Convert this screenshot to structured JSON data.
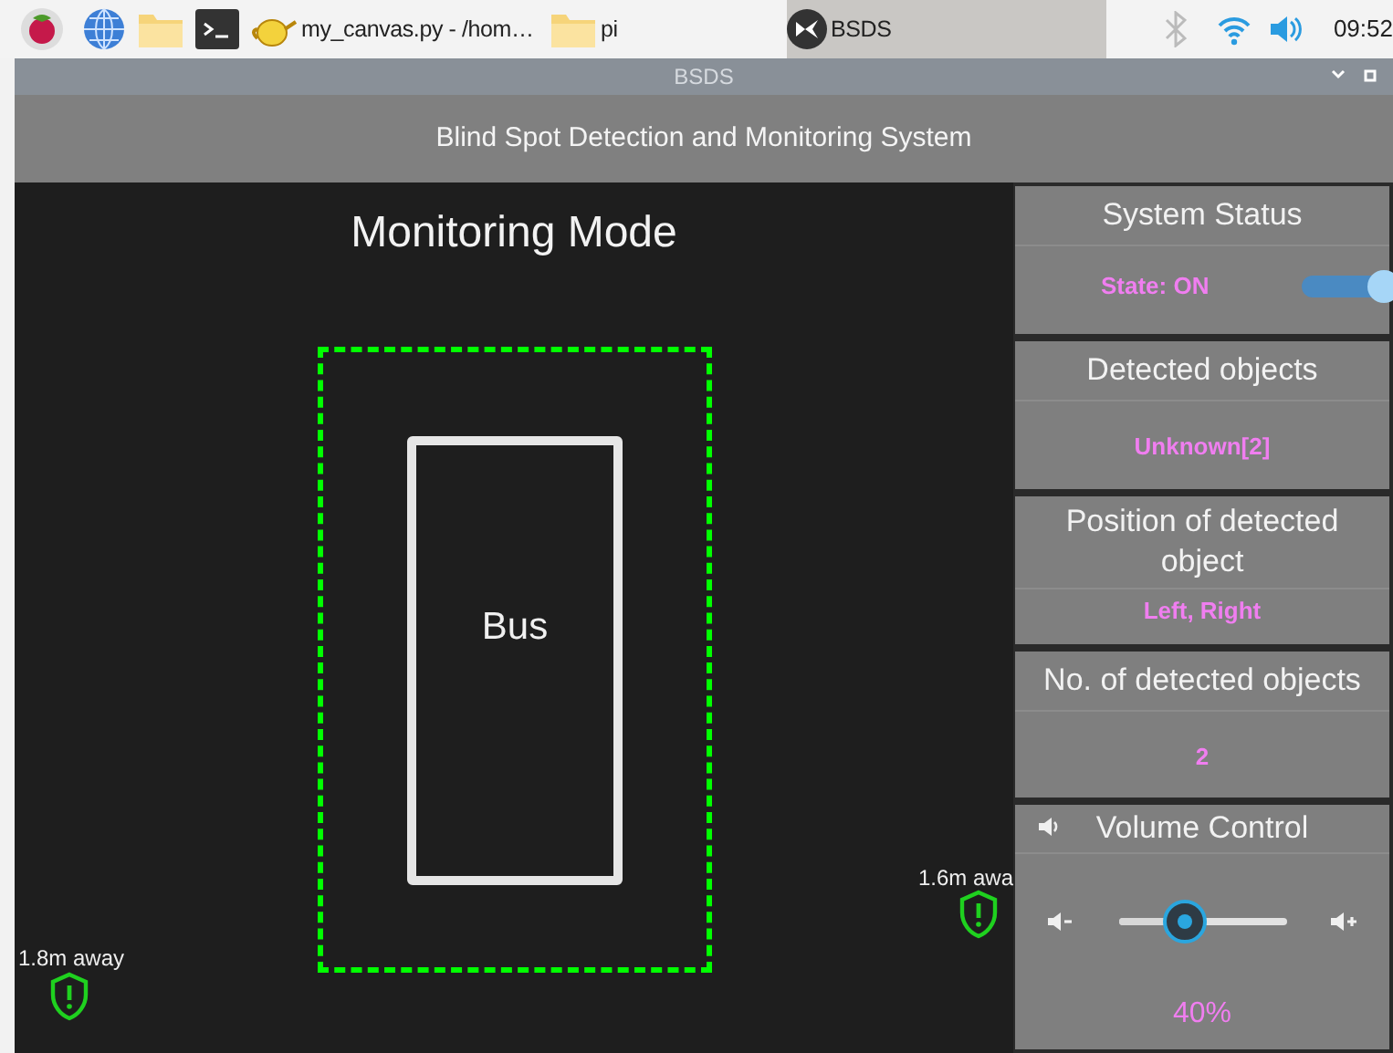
{
  "taskbar": {
    "windows": [
      {
        "kind": "python",
        "label": "my_canvas.py - /hom…",
        "selected": false
      },
      {
        "kind": "folder",
        "label": "pi",
        "selected": false
      },
      {
        "kind": "app",
        "label": "BSDS",
        "selected": true
      }
    ],
    "clock": "09:52"
  },
  "window": {
    "title": "BSDS"
  },
  "app_header": "Blind Spot Detection and Monitoring System",
  "monitor": {
    "title": "Monitoring Mode",
    "vehicle": "Bus",
    "sensors": [
      {
        "kind": "edge",
        "reading": "1.8m away"
      },
      {
        "kind": "near",
        "reading": "1.6m awa"
      }
    ]
  },
  "panels": [
    {
      "kind": "status",
      "title": "System Status",
      "value": "State: ON",
      "on": true
    },
    {
      "kind": "text",
      "title": "Detected objects",
      "value": "Unknown[2]"
    },
    {
      "kind": "text",
      "title": "Position of detected object",
      "value": "Left, Right"
    },
    {
      "kind": "text",
      "title": "No. of detected objects",
      "value": "2"
    },
    {
      "kind": "volume",
      "title": "Volume Control",
      "level": 0.4,
      "value": "40%"
    }
  ]
}
